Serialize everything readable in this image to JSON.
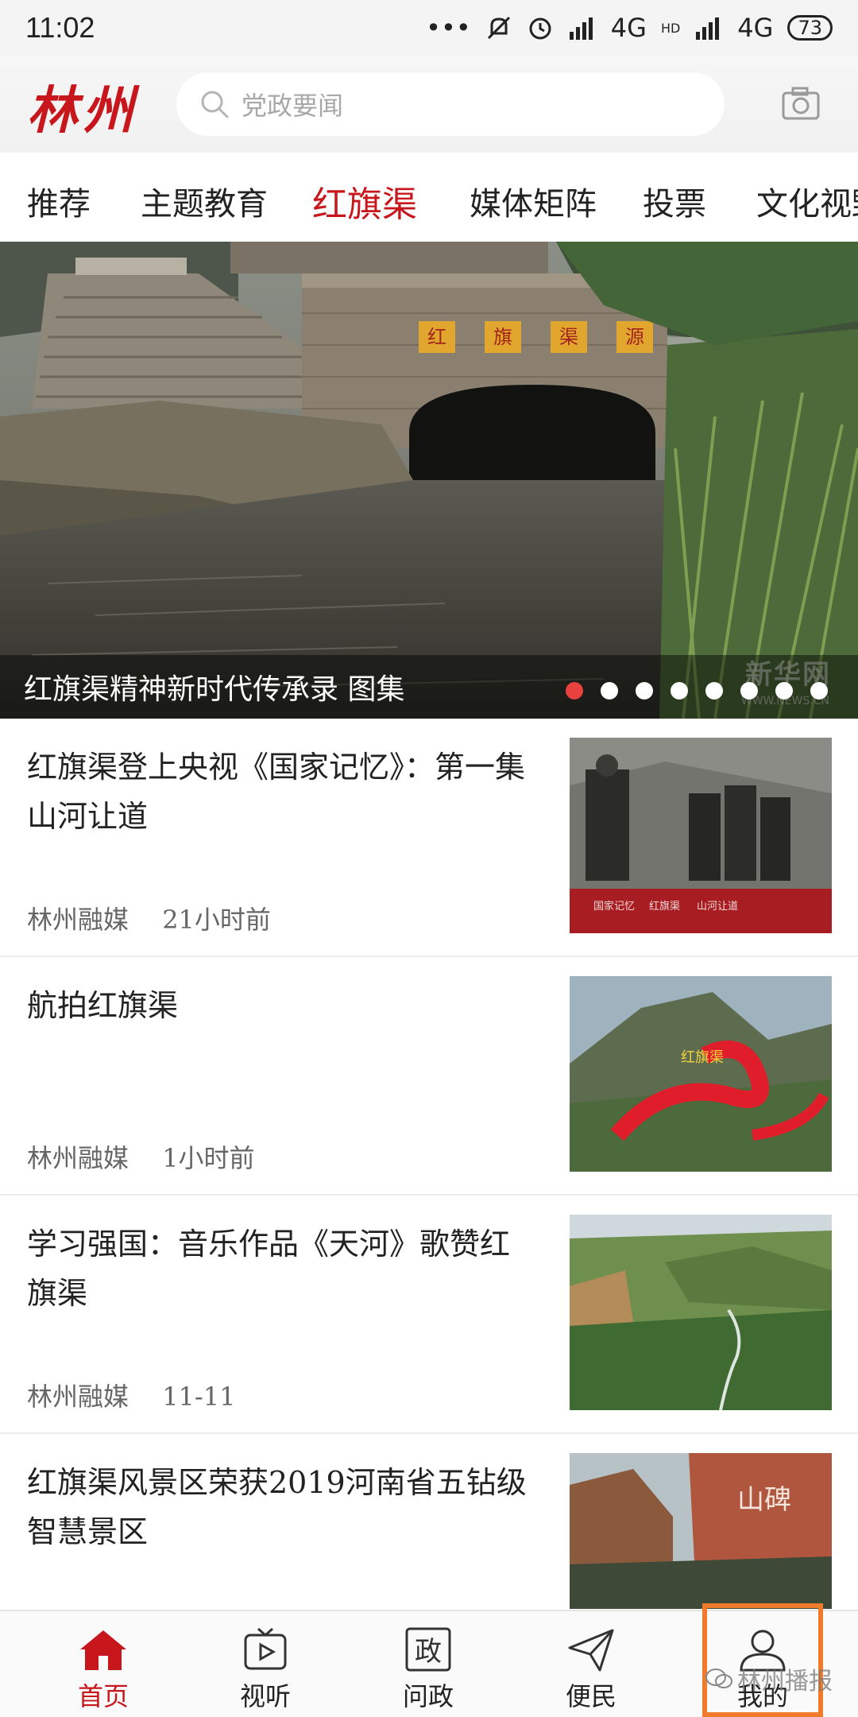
{
  "status_bar": {
    "time": "11:02",
    "signal_1": "4G",
    "signal_2": "4G",
    "hd": "HD",
    "battery": "73"
  },
  "header": {
    "logo": "林州",
    "search_placeholder": "党政要闻"
  },
  "tabs": [
    {
      "label": "推荐"
    },
    {
      "label": "主题教育"
    },
    {
      "label": "红旗渠",
      "active": true
    },
    {
      "label": "媒体矩阵"
    },
    {
      "label": "投票"
    },
    {
      "label": "文化视野"
    }
  ],
  "hero": {
    "caption": "红旗渠精神新时代传承录 图集",
    "sign_text": "红旗渠源",
    "watermark": "新华网",
    "watermark_sub": "WWW.NEWS.CN",
    "dot_count": 8,
    "active_dot": 0
  },
  "news": [
    {
      "title": "红旗渠登上央视《国家记忆》：第一集 山河让道",
      "source": "林州融媒",
      "time": "21小时前",
      "thumb": "cctv-still",
      "thumb_labels": [
        "国家记忆",
        "红旗渠",
        "山河让道"
      ]
    },
    {
      "title": "航拍红旗渠",
      "source": "林州融媒",
      "time": "1小时前",
      "thumb": "aerial-red-bridge",
      "thumb_labels": [
        "红旗渠"
      ]
    },
    {
      "title": "学习强国：音乐作品《天河》歌赞红旗渠",
      "source": "林州融媒",
      "time": "11-11",
      "thumb": "green-valley",
      "thumb_labels": []
    },
    {
      "title": "红旗渠风景区荣获2019河南省五钻级智慧景区",
      "source": "",
      "time": "",
      "thumb": "cliff-inscription",
      "thumb_labels": [
        "山碑"
      ]
    }
  ],
  "bottom_nav": [
    {
      "label": "首页",
      "icon": "home-icon",
      "active": true
    },
    {
      "label": "视听",
      "icon": "tv-play-icon"
    },
    {
      "label": "问政",
      "icon": "zheng-badge-icon",
      "glyph": "政"
    },
    {
      "label": "便民",
      "icon": "paper-plane-icon"
    },
    {
      "label": "我的",
      "icon": "user-icon"
    }
  ],
  "footer_watermark": "林州播报",
  "colors": {
    "accent": "#c8161d",
    "highlight": "#f07b2a"
  }
}
